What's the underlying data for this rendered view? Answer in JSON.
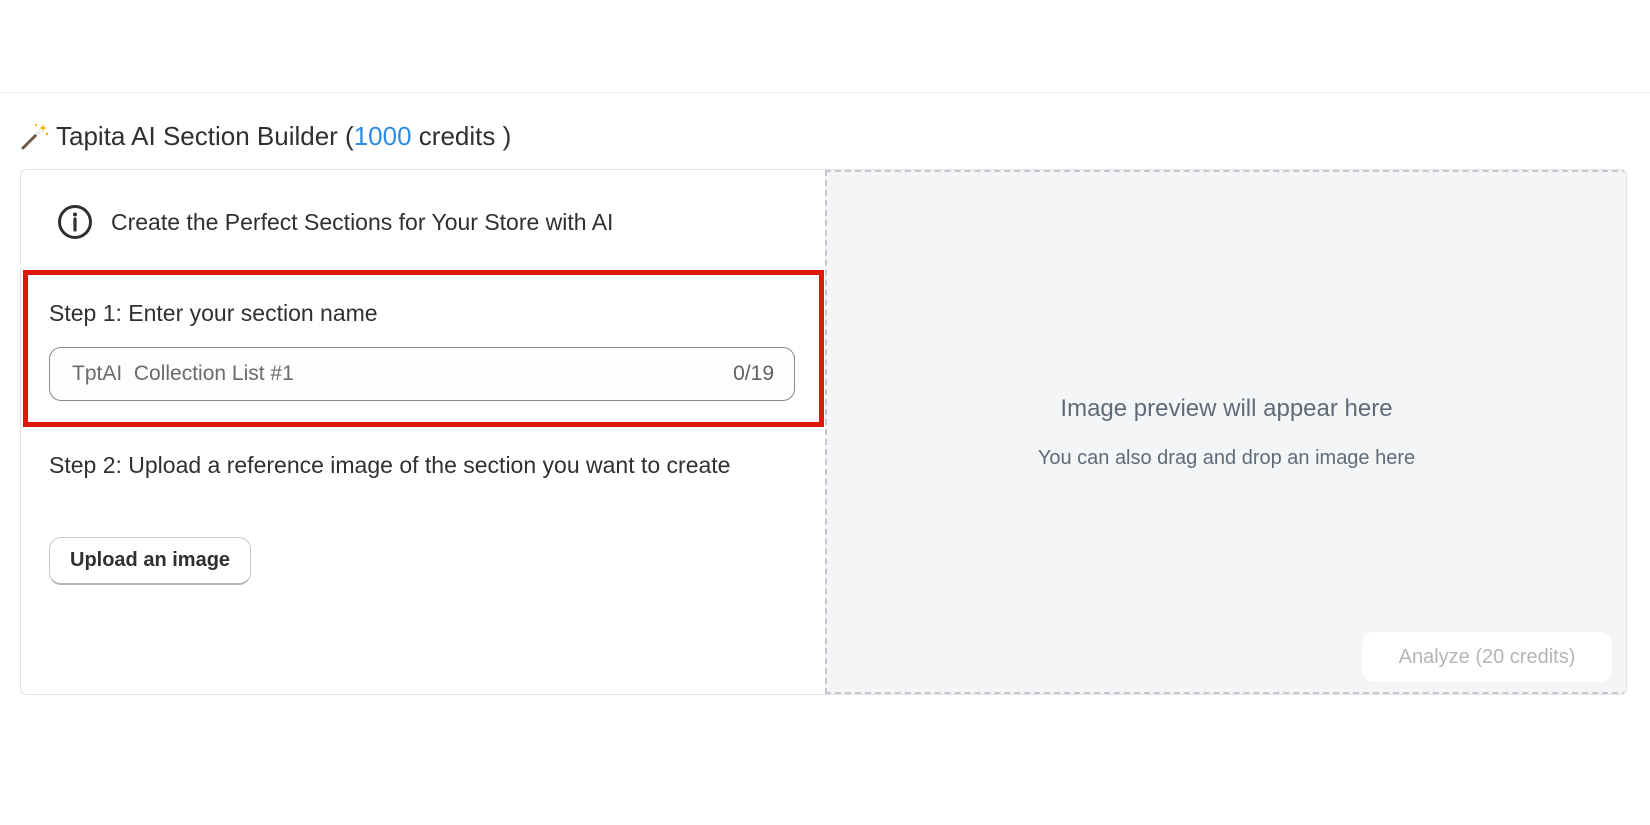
{
  "header": {
    "icon": "magic-wand-icon",
    "title_prefix": "Tapita AI Section Builder (",
    "credits": "1000",
    "title_suffix": " credits )",
    "credits_color": "#2c8ce6"
  },
  "banner": {
    "icon": "info-icon",
    "text": "Create the Perfect Sections for Your Store with AI"
  },
  "step1": {
    "label": "Step 1: Enter your section name",
    "placeholder": "TptAI  Collection List #1",
    "value": "",
    "counter": "0/19",
    "highlight_color": "#e0170b"
  },
  "step2": {
    "label": "Step 2: Upload a reference image of the section you want to create",
    "button_label": "Upload an image"
  },
  "dropzone": {
    "title": "Image preview will appear here",
    "subtitle": "You can also drag and drop an image here",
    "analyze_label": "Analyze (20 credits)"
  }
}
